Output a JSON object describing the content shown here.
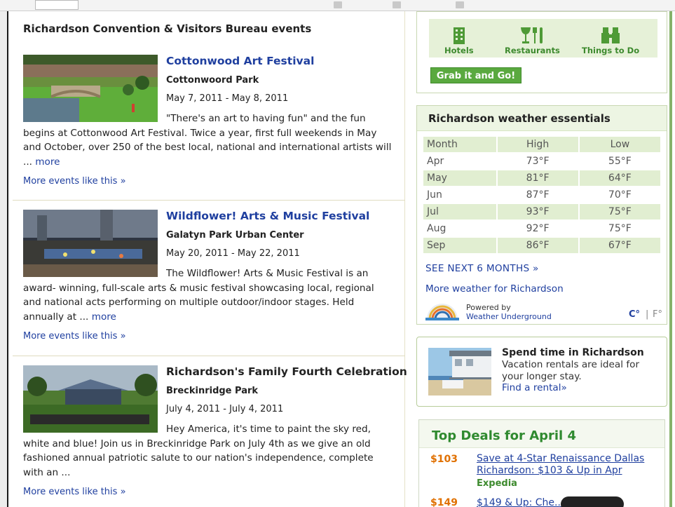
{
  "colors": {
    "link": "#1f3f9f",
    "green": "#5aa93f",
    "deal_price": "#e07000",
    "green_text": "#3d8a2e"
  },
  "events": {
    "title": "Richardson Convention & Visitors Bureau events",
    "items": [
      {
        "title": "Cottonwood Art Festival",
        "venue": "Cottonwoord Park",
        "date": "May 7, 2011 - May 8, 2011",
        "description": "\"There's an art to having fun\" and the fun begins at Cottonwood Art Festival. Twice a year, first full weekends in May and October, over 250 of the best local, national and international artists will ...",
        "more_label": "more",
        "more_events": "More events like this »"
      },
      {
        "title": "Wildflower! Arts & Music Festival",
        "venue": "Galatyn Park Urban Center",
        "date": "May 20, 2011 - May 22, 2011",
        "description": "The Wildflower! Arts & Music Festival is an award- winning, full-scale arts & music festival showcasing local, regional and national acts performing on multiple outdoor/indoor stages. Held annually at ...",
        "more_label": "more",
        "more_events": "More events like this »"
      },
      {
        "title": "Richardson's Family Fourth Celebration",
        "venue": "Breckinridge Park",
        "date": "July 4, 2011 - July 4, 2011",
        "description": "Hey America, it's time to paint the sky red, white and blue! Join us in Breckinridge Park on July 4th as we give an old fashioned annual patriotic salute to our nation's independence, complete with an ...",
        "more_label": "",
        "more_events": "More events like this »"
      }
    ]
  },
  "quick": {
    "items": [
      {
        "label": "Hotels",
        "icon": "hotel-icon"
      },
      {
        "label": "Restaurants",
        "icon": "restaurant-icon"
      },
      {
        "label": "Things to Do",
        "icon": "binoculars-icon"
      }
    ],
    "button": "Grab it and Go!"
  },
  "weather": {
    "title": "Richardson weather essentials",
    "headers": [
      "Month",
      "High",
      "Low"
    ],
    "rows": [
      [
        "Apr",
        "73°F",
        "55°F"
      ],
      [
        "May",
        "81°F",
        "64°F"
      ],
      [
        "Jun",
        "87°F",
        "70°F"
      ],
      [
        "Jul",
        "93°F",
        "75°F"
      ],
      [
        "Aug",
        "92°F",
        "75°F"
      ],
      [
        "Sep",
        "86°F",
        "67°F"
      ]
    ],
    "next_link": "SEE NEXT 6 MONTHS »",
    "more_link": "More weather for Richardson",
    "powered_by": "Powered by",
    "provider": "Weather Underground",
    "unit_c": "C°",
    "unit_sep": "|",
    "unit_f": "F°"
  },
  "spend": {
    "title": "Spend time in Richardson",
    "text": "Vacation rentals are ideal for your longer stay.",
    "link": "Find a rental»"
  },
  "deals": {
    "title": "Top Deals for April 4",
    "items": [
      {
        "price": "$103",
        "text": "Save at 4-Star Renaissance Dallas Richardson: $103 & Up in Apr",
        "source": "Expedia"
      },
      {
        "price": "$149",
        "text": "$149 & Up: Che... n Stay",
        "source": ""
      }
    ]
  }
}
